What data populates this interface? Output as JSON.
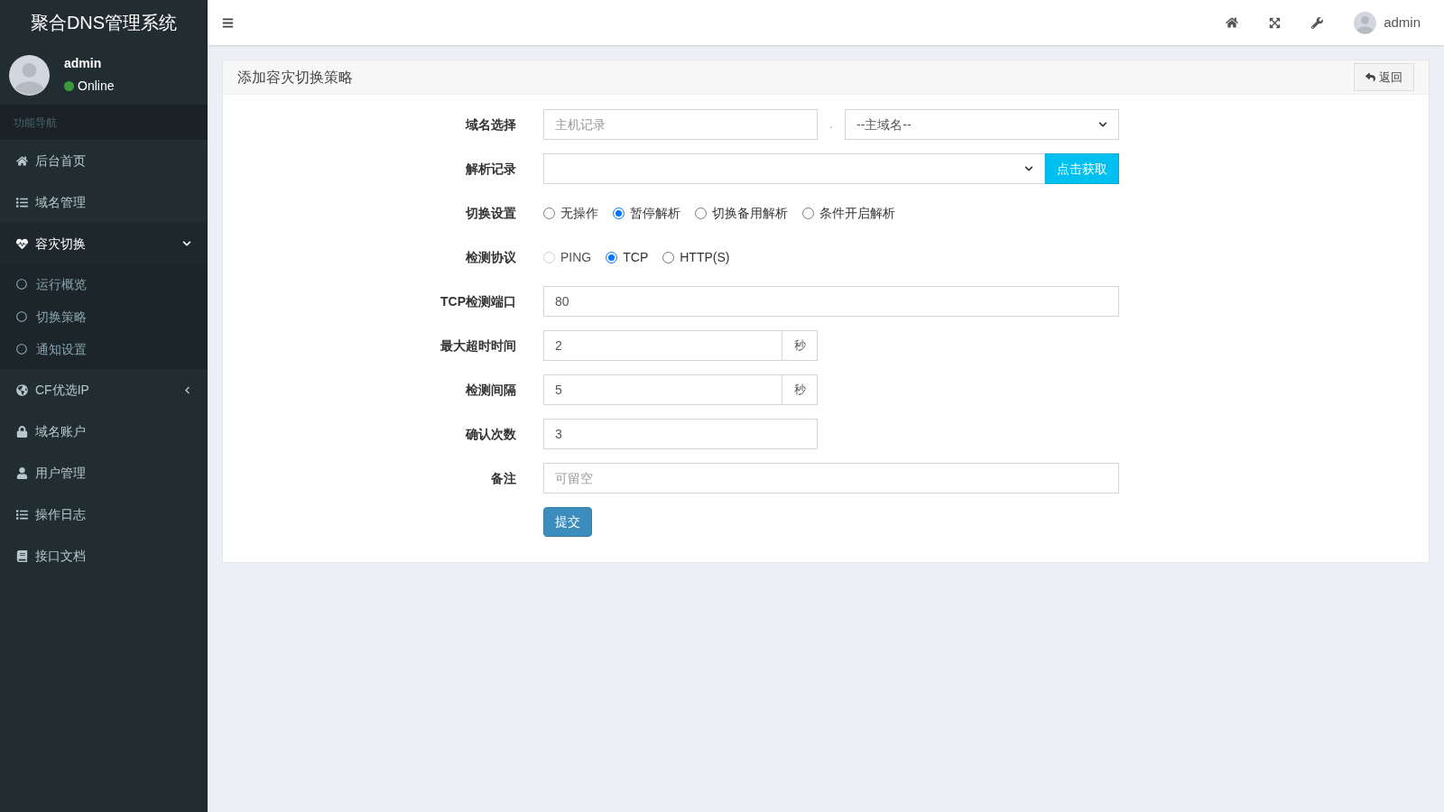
{
  "sidebar": {
    "title": "聚合DNS管理系统",
    "user": {
      "name": "admin",
      "status": "Online"
    },
    "section_header": "功能导航",
    "items": [
      {
        "kind": "link",
        "label": "后台首页"
      },
      {
        "kind": "link",
        "label": "域名管理"
      },
      {
        "kind": "group",
        "label": "容灾切换",
        "expanded": true,
        "children": [
          {
            "label": "运行概览"
          },
          {
            "label": "切换策略"
          },
          {
            "label": "通知设置"
          }
        ]
      },
      {
        "kind": "group",
        "label": "CF优选IP",
        "expanded": false
      },
      {
        "kind": "link",
        "label": "域名账户"
      },
      {
        "kind": "link",
        "label": "用户管理"
      },
      {
        "kind": "link",
        "label": "操作日志"
      },
      {
        "kind": "link",
        "label": "接口文档"
      }
    ]
  },
  "topbar": {
    "user": "admin"
  },
  "card": {
    "title": "添加容灾切换策略",
    "back_button": "返回",
    "rows": [
      {
        "kind": "split",
        "label": "域名选择",
        "placeholder": "主机记录",
        "separator": ".",
        "select": "--主域名--"
      },
      {
        "kind": "select_button",
        "label": "解析记录",
        "button": "点击获取"
      },
      {
        "kind": "radio",
        "label": "切换设置",
        "options": [
          {
            "label": "无操作",
            "selected": false,
            "disabled": false
          },
          {
            "label": "暂停解析",
            "selected": true,
            "disabled": false
          },
          {
            "label": "切换备用解析",
            "selected": false,
            "disabled": false
          },
          {
            "label": "条件开启解析",
            "selected": false,
            "disabled": false
          }
        ]
      },
      {
        "kind": "radio",
        "label": "检测协议",
        "options": [
          {
            "label": "PING",
            "selected": false,
            "disabled": true
          },
          {
            "label": "TCP",
            "selected": true,
            "disabled": false
          },
          {
            "label": "HTTP(S)",
            "selected": false,
            "disabled": false
          }
        ]
      },
      {
        "kind": "input",
        "label": "TCP检测端口",
        "value": "80",
        "wide": true
      },
      {
        "kind": "input_addon",
        "label": "最大超时时间",
        "value": "2",
        "addon": "秒"
      },
      {
        "kind": "input_addon",
        "label": "检测间隔",
        "value": "5",
        "addon": "秒"
      },
      {
        "kind": "input",
        "label": "确认次数",
        "value": "3",
        "wide": false
      },
      {
        "kind": "input",
        "label": "备注",
        "placeholder": "可留空",
        "wide": true
      }
    ],
    "submit": "提交"
  }
}
